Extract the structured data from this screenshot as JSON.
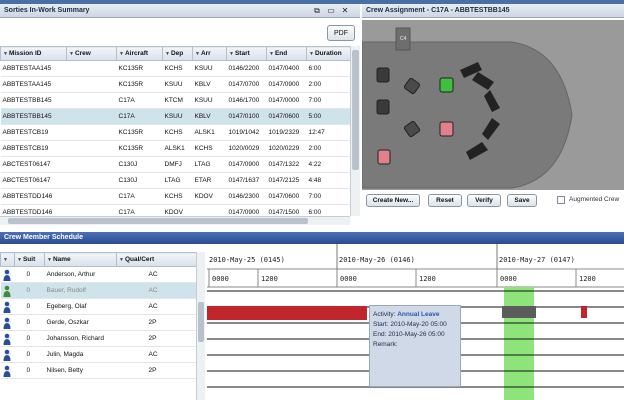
{
  "sorties": {
    "title": "Sorties In-Work Summary",
    "pdf_label": "PDF",
    "columns": [
      "Mission ID",
      "Crew",
      "Aircraft",
      "Dep",
      "Arr",
      "Start",
      "End",
      "Duration"
    ],
    "rows": [
      [
        "ABBTESTAA145",
        "",
        "KC135R",
        "KCHS",
        "KSUU",
        "0146/2200",
        "0147/0400",
        "6:00"
      ],
      [
        "ABBTESTAA145",
        "",
        "KC135R",
        "KSUU",
        "KBLV",
        "0147/0700",
        "0147/0900",
        "2:00"
      ],
      [
        "ABBTESTBB145",
        "",
        "C17A",
        "KTCM",
        "KSUU",
        "0146/1700",
        "0147/0000",
        "7:00"
      ],
      [
        "ABBTESTBB145",
        "",
        "C17A",
        "KSUU",
        "KBLV",
        "0147/0100",
        "0147/0600",
        "5:00"
      ],
      [
        "ABBTESTCB19",
        "",
        "KC135R",
        "KCHS",
        "ALSK1",
        "1019/1042",
        "1019/2329",
        "12:47"
      ],
      [
        "ABBTESTCB19",
        "",
        "KC135R",
        "ALSK1",
        "KCHS",
        "1020/0029",
        "1020/0229",
        "2:00"
      ],
      [
        "ABCTEST06147",
        "",
        "C130J",
        "DMFJ",
        "LTAG",
        "0147/0900",
        "0147/1322",
        "4:22"
      ],
      [
        "ABCTEST06147",
        "",
        "C130J",
        "LTAG",
        "ETAR",
        "0147/1637",
        "0147/2125",
        "4:48"
      ],
      [
        "ABBTESTDD146",
        "",
        "C17A",
        "KCHS",
        "KDOV",
        "0146/2300",
        "0147/0600",
        "7:00"
      ],
      [
        "ABBTESTDD146",
        "",
        "C17A",
        "KDOV",
        "",
        "0147/0900",
        "0147/1500",
        "6:00"
      ]
    ]
  },
  "crew_assignment": {
    "title": "Crew Assignment - C17A - ABBTESTBB145",
    "seat_label": "C4",
    "buttons": {
      "create": "Create New...",
      "reset": "Reset",
      "verify": "Verify",
      "save": "Save"
    },
    "augmented_label": "Augmented Crew",
    "colors": {
      "fuselage": "#7a7a7a",
      "empty_seat": "#5a5a5a",
      "occupied_seat": "#e0808b",
      "active_seat": "#3ec03e"
    }
  },
  "schedule": {
    "title": "Crew Member Schedule",
    "columns": [
      "Suit",
      "Name",
      "Qual/Cert"
    ],
    "rows": [
      {
        "suit": "0",
        "name": "Anderson, Arthur",
        "qual": "AC"
      },
      {
        "suit": "0",
        "name": "Bauer, Rudolf",
        "qual": "AC"
      },
      {
        "suit": "0",
        "name": "Egeberg, Olaf",
        "qual": "AC"
      },
      {
        "suit": "0",
        "name": "Gerde, Oszkar",
        "qual": "2P"
      },
      {
        "suit": "0",
        "name": "Johansson, Richard",
        "qual": "2P"
      },
      {
        "suit": "0",
        "name": "Julin, Magda",
        "qual": "AC"
      },
      {
        "suit": "0",
        "name": "Nilsen, Betty",
        "qual": "2P"
      }
    ],
    "days": [
      "2010-May-25 (0145)",
      "2010-May-26 (0146)",
      "2010-May-27 (0147)"
    ],
    "hours": [
      "0000",
      "1200",
      "0000",
      "1200",
      "0000",
      "1200"
    ],
    "colors": {
      "leave": "#c0262b",
      "duty": "#5c5c5c",
      "today": "#8ee47a",
      "avatar": "#2a4f9a"
    },
    "tooltip": {
      "activity_key": "Activity:",
      "activity_val": "Annual Leave",
      "start_key": "Start:",
      "start_val": "2010-May-20 05:00",
      "end_key": "End:",
      "end_val": "2010-May-26 05:00",
      "remark_key": "Remark:"
    }
  }
}
